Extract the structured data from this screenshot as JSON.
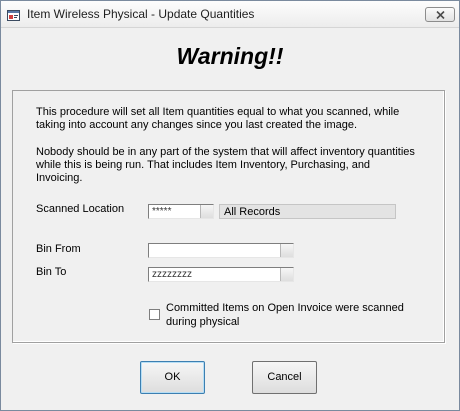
{
  "window": {
    "title": "Item Wireless Physical - Update Quantities",
    "app_icon": "window-app-icon",
    "close_icon": "close-icon"
  },
  "heading": "Warning!!",
  "messages": {
    "paragraph1": "This procedure will set all Item quantities equal to what you scanned, while taking into account any changes since you last created the image.",
    "paragraph2": "Nobody should be in any part of the system that will affect inventory quantities while this is being run.  That includes Item Inventory, Purchasing, and Invoicing."
  },
  "form": {
    "scanned_location": {
      "label": "Scanned Location",
      "value": "*****",
      "description": "All Records"
    },
    "bin_from": {
      "label": "Bin From",
      "value": ""
    },
    "bin_to": {
      "label": "Bin To",
      "value": "zzzzzzzz"
    },
    "committed_items": {
      "label": "Committed Items on Open Invoice were scanned during physical",
      "checked": false
    }
  },
  "buttons": {
    "ok": "OK",
    "cancel": "Cancel"
  }
}
